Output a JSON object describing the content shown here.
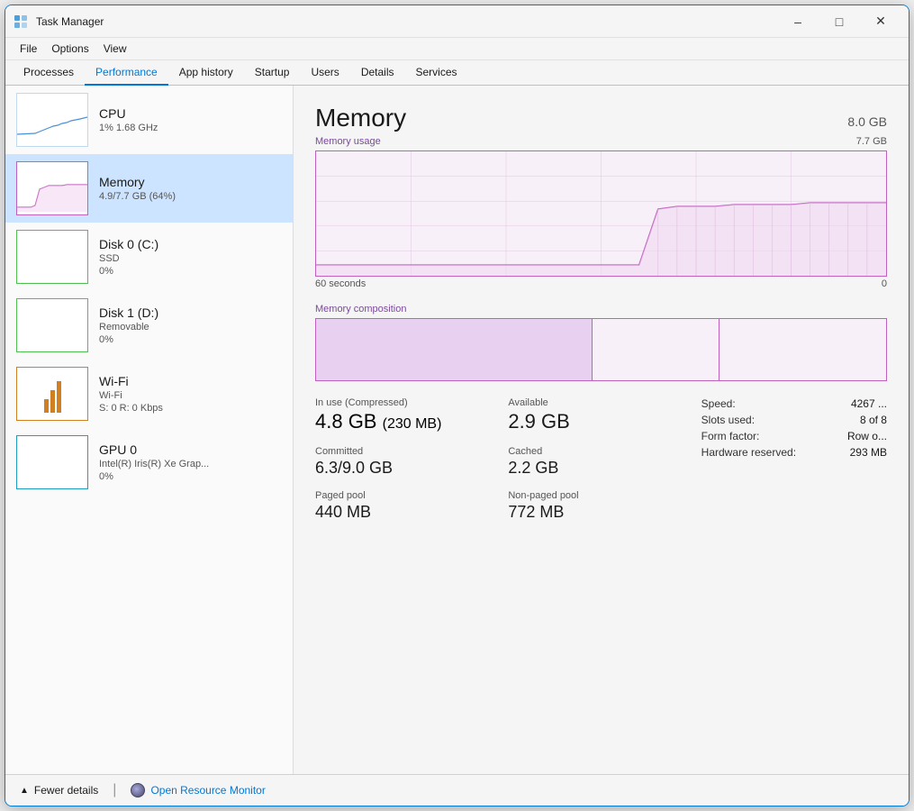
{
  "window": {
    "title": "Task Manager",
    "icon": "📊"
  },
  "menu": {
    "items": [
      "File",
      "Options",
      "View"
    ]
  },
  "tabs": [
    {
      "label": "Processes",
      "active": false
    },
    {
      "label": "Performance",
      "active": true
    },
    {
      "label": "App history",
      "active": false
    },
    {
      "label": "Startup",
      "active": false
    },
    {
      "label": "Users",
      "active": false
    },
    {
      "label": "Details",
      "active": false
    },
    {
      "label": "Services",
      "active": false
    }
  ],
  "sidebar": {
    "items": [
      {
        "name": "CPU",
        "sub1": "1%  1.68 GHz",
        "sub2": "",
        "active": false,
        "type": "cpu"
      },
      {
        "name": "Memory",
        "sub1": "4.9/7.7 GB (64%)",
        "sub2": "",
        "active": true,
        "type": "memory"
      },
      {
        "name": "Disk 0 (C:)",
        "sub1": "SSD",
        "sub2": "0%",
        "active": false,
        "type": "disk"
      },
      {
        "name": "Disk 1 (D:)",
        "sub1": "Removable",
        "sub2": "0%",
        "active": false,
        "type": "disk1"
      },
      {
        "name": "Wi-Fi",
        "sub1": "Wi-Fi",
        "sub2": "S: 0 R: 0 Kbps",
        "active": false,
        "type": "wifi"
      },
      {
        "name": "GPU 0",
        "sub1": "Intel(R) Iris(R) Xe Grap...",
        "sub2": "0%",
        "active": false,
        "type": "gpu"
      }
    ]
  },
  "main": {
    "title": "Memory",
    "total": "8.0 GB",
    "chart": {
      "usage_label": "Memory usage",
      "usage_value": "7.7 GB",
      "time_left": "60 seconds",
      "time_right": "0"
    },
    "composition_label": "Memory composition",
    "stats": {
      "in_use_label": "In use (Compressed)",
      "in_use_value": "4.8 GB",
      "compressed": "(230 MB)",
      "available_label": "Available",
      "available_value": "2.9 GB",
      "committed_label": "Committed",
      "committed_value": "6.3/9.0 GB",
      "cached_label": "Cached",
      "cached_value": "2.2 GB",
      "paged_label": "Paged pool",
      "paged_value": "440 MB",
      "nonpaged_label": "Non-paged pool",
      "nonpaged_value": "772 MB"
    },
    "right_stats": {
      "speed_label": "Speed:",
      "speed_value": "4267 ...",
      "slots_label": "Slots used:",
      "slots_value": "8 of 8",
      "form_label": "Form factor:",
      "form_value": "Row o...",
      "hw_label": "Hardware reserved:",
      "hw_value": "293 MB"
    }
  },
  "bottom": {
    "fewer_details": "Fewer details",
    "open_monitor": "Open Resource Monitor",
    "chevron_down": "▲"
  }
}
